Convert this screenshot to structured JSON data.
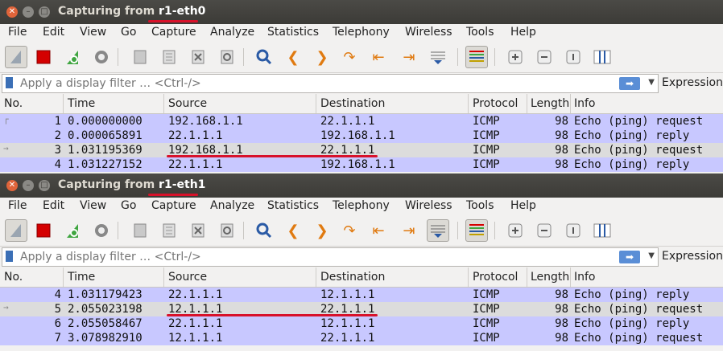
{
  "windows": [
    {
      "title_prefix": "Capturing from ",
      "interface": "r1-eth0",
      "menu": [
        "File",
        "Edit",
        "View",
        "Go",
        "Capture",
        "Analyze",
        "Statistics",
        "Telephony",
        "Wireless",
        "Tools",
        "Help"
      ],
      "filter_placeholder": "Apply a display filter … <Ctrl-/>",
      "expression_label": "Expression",
      "columns": [
        "No.",
        "Time",
        "Source",
        "Destination",
        "Protocol",
        "Length",
        "Info"
      ],
      "rows": [
        {
          "no": "1",
          "time": "0.000000000",
          "src": "192.168.1.1",
          "dst": "22.1.1.1",
          "proto": "ICMP",
          "len": "98",
          "info": "Echo (ping) request",
          "style": "icmp"
        },
        {
          "no": "2",
          "time": "0.000065891",
          "src": "22.1.1.1",
          "dst": "192.168.1.1",
          "proto": "ICMP",
          "len": "98",
          "info": "Echo (ping) reply",
          "style": "icmp"
        },
        {
          "no": "3",
          "time": "1.031195369",
          "src": "192.168.1.1",
          "dst": "22.1.1.1",
          "proto": "ICMP",
          "len": "98",
          "info": "Echo (ping) request",
          "style": "sel"
        },
        {
          "no": "4",
          "time": "1.031227152",
          "src": "22.1.1.1",
          "dst": "192.168.1.1",
          "proto": "ICMP",
          "len": "98",
          "info": "Echo (ping) reply",
          "style": "icmp"
        }
      ]
    },
    {
      "title_prefix": "Capturing from ",
      "interface": "r1-eth1",
      "menu": [
        "File",
        "Edit",
        "View",
        "Go",
        "Capture",
        "Analyze",
        "Statistics",
        "Telephony",
        "Wireless",
        "Tools",
        "Help"
      ],
      "filter_placeholder": "Apply a display filter … <Ctrl-/>",
      "expression_label": "Expression",
      "columns": [
        "No.",
        "Time",
        "Source",
        "Destination",
        "Protocol",
        "Length",
        "Info"
      ],
      "rows": [
        {
          "no": "4",
          "time": "1.031179423",
          "src": "22.1.1.1",
          "dst": "12.1.1.1",
          "proto": "ICMP",
          "len": "98",
          "info": "Echo (ping) reply",
          "style": "icmp"
        },
        {
          "no": "5",
          "time": "2.055023198",
          "src": "12.1.1.1",
          "dst": "22.1.1.1",
          "proto": "ICMP",
          "len": "98",
          "info": "Echo (ping) request",
          "style": "sel"
        },
        {
          "no": "6",
          "time": "2.055058467",
          "src": "22.1.1.1",
          "dst": "12.1.1.1",
          "proto": "ICMP",
          "len": "98",
          "info": "Echo (ping) reply",
          "style": "icmp"
        },
        {
          "no": "7",
          "time": "3.078982910",
          "src": "12.1.1.1",
          "dst": "22.1.1.1",
          "proto": "ICMP",
          "len": "98",
          "info": "Echo (ping) request",
          "style": "icmp"
        }
      ]
    }
  ],
  "toolbar_icons": [
    "shark-fin-icon",
    "stop-icon",
    "restart-icon",
    "options-gear-icon",
    "open-file-icon",
    "save-file-icon",
    "close-file-icon",
    "reload-icon",
    "find-icon",
    "back-icon",
    "forward-icon",
    "goto-icon",
    "first-packet-icon",
    "last-packet-icon",
    "autoscroll-icon",
    "colorize-icon",
    "zoom-in-icon",
    "zoom-out-icon",
    "normal-size-icon",
    "resize-columns-icon"
  ],
  "colors": {
    "icmp_row": "#c8c8ff",
    "selected_row": "#dcdcdc",
    "highlight": "#d8112a",
    "titlebar": "#3c3b37"
  }
}
